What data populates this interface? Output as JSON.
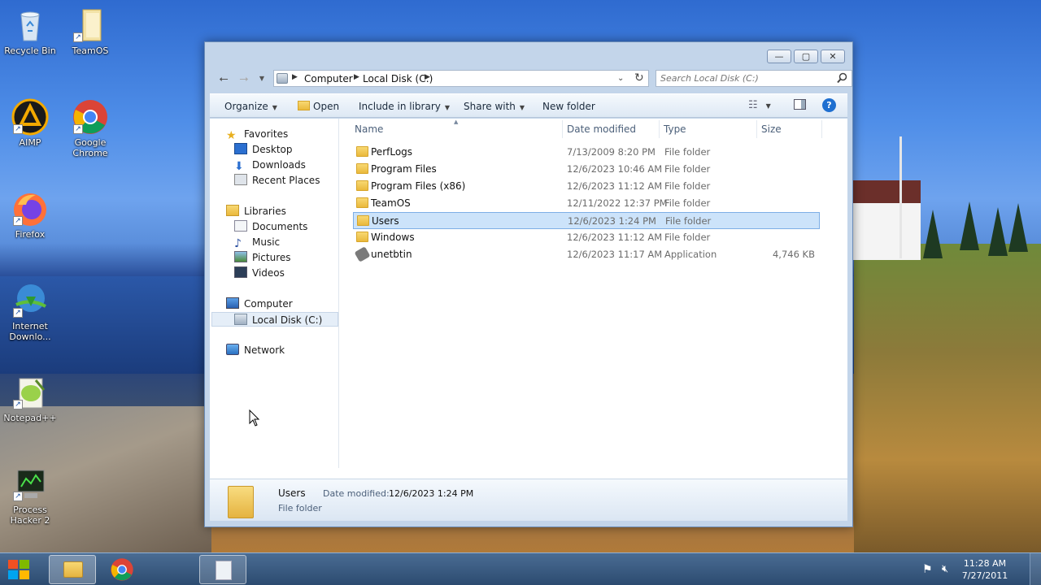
{
  "desktop_icons": [
    {
      "label": "Recycle Bin",
      "icon": "recycle-bin-icon"
    },
    {
      "label": "TeamOS",
      "icon": "folder-icon"
    },
    {
      "label": "AIMP",
      "icon": "aimp-icon"
    },
    {
      "label": "Google Chrome",
      "icon": "chrome-icon"
    },
    {
      "label": "Firefox",
      "icon": "firefox-icon"
    },
    {
      "label": "Internet Downlo...",
      "icon": "idm-icon"
    },
    {
      "label": "Notepad++",
      "icon": "notepadpp-icon"
    },
    {
      "label": "Process Hacker 2",
      "icon": "process-hacker-icon"
    }
  ],
  "window": {
    "controls": {
      "minimize": "—",
      "maximize": "▢",
      "close": "✕"
    },
    "address": {
      "crumbs": [
        "Computer",
        "Local Disk (C:)"
      ]
    },
    "search": {
      "placeholder": "Search Local Disk (C:)"
    },
    "toolbar": {
      "organize": "Organize",
      "open": "Open",
      "include_in_library": "Include in library",
      "share_with": "Share with",
      "new_folder": "New folder"
    },
    "nav": {
      "favorites": "Favorites",
      "desktop": "Desktop",
      "downloads": "Downloads",
      "recent_places": "Recent Places",
      "libraries": "Libraries",
      "documents": "Documents",
      "music": "Music",
      "pictures": "Pictures",
      "videos": "Videos",
      "computer": "Computer",
      "local_disk": "Local Disk (C:)",
      "network": "Network"
    },
    "columns": {
      "name": "Name",
      "date_modified": "Date modified",
      "type": "Type",
      "size": "Size"
    },
    "files": [
      {
        "name": "PerfLogs",
        "date": "7/13/2009 8:20 PM",
        "type": "File folder",
        "size": ""
      },
      {
        "name": "Program Files",
        "date": "12/6/2023 10:46 AM",
        "type": "File folder",
        "size": ""
      },
      {
        "name": "Program Files (x86)",
        "date": "12/6/2023 11:12 AM",
        "type": "File folder",
        "size": ""
      },
      {
        "name": "TeamOS",
        "date": "12/11/2022 12:37 PM",
        "type": "File folder",
        "size": ""
      },
      {
        "name": "Users",
        "date": "12/6/2023 1:24 PM",
        "type": "File folder",
        "size": ""
      },
      {
        "name": "Windows",
        "date": "12/6/2023 11:12 AM",
        "type": "File folder",
        "size": ""
      },
      {
        "name": "unetbtin",
        "date": "12/6/2023 11:17 AM",
        "type": "Application",
        "size": "4,746 KB"
      }
    ],
    "selected_index": 4,
    "details": {
      "name": "Users",
      "date_label": "Date modified:",
      "date_value": "12/6/2023 1:24 PM",
      "type": "File folder"
    }
  },
  "taskbar": {
    "time": "11:28 AM",
    "date": "7/27/2011"
  },
  "colors": {
    "selection": "#cce3fa",
    "selection_border": "#7daee6",
    "window_frame": "#c3d5ea",
    "taskbar": "#2c4b70"
  }
}
